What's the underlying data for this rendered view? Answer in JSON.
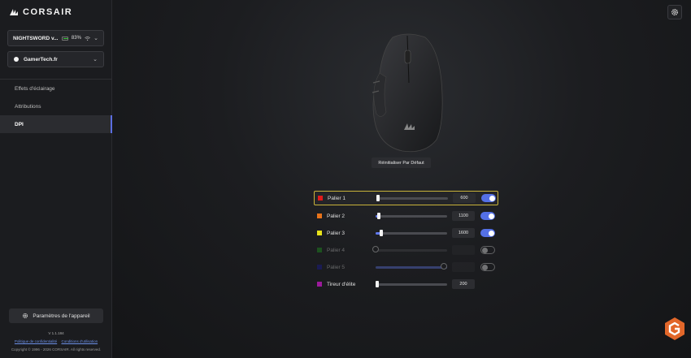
{
  "app": {
    "logo_text": "CORSAIR"
  },
  "device": {
    "name": "NIGHTSWORD v...",
    "battery": "83%"
  },
  "profile": {
    "name": "GamerTech.fr"
  },
  "nav": {
    "items": [
      {
        "label": "Effets d'éclairage"
      },
      {
        "label": "Attributions"
      },
      {
        "label": "DPI"
      }
    ],
    "active": "DPI"
  },
  "footer": {
    "settings_label": "Paramètres de l'appareil",
    "version": "V 1.1.184",
    "privacy_link": "Politique de confidentialité",
    "terms_link": "Conditions d'utilisation",
    "copyright": "Copyright © 1996 - 2026 CORSAIR. All rights reserved."
  },
  "main": {
    "reset_label": "Réinitialiser Par Défaut",
    "dpi_rows": [
      {
        "label": "Palier 1",
        "color": "#e01b1b",
        "value": "600",
        "level": 0.02,
        "enabled": true,
        "has_toggle": true,
        "selected": true
      },
      {
        "label": "Palier 2",
        "color": "#e8731a",
        "value": "1100",
        "level": 0.05,
        "enabled": true,
        "has_toggle": true,
        "selected": false
      },
      {
        "label": "Palier 3",
        "color": "#e8e21a",
        "value": "1600",
        "level": 0.08,
        "enabled": true,
        "has_toggle": true,
        "selected": false
      },
      {
        "label": "Palier 4",
        "color": "#1fa51f",
        "value": "",
        "level": 0.0,
        "enabled": false,
        "has_toggle": true,
        "selected": false
      },
      {
        "label": "Palier 5",
        "color": "#1a1aa8",
        "value": "",
        "level": 1.0,
        "enabled": false,
        "has_toggle": true,
        "selected": false
      },
      {
        "label": "Tireur d'élite",
        "color": "#9b1a9b",
        "value": "200",
        "level": 0.0,
        "enabled": true,
        "has_toggle": false,
        "selected": false
      }
    ]
  },
  "icons": {
    "logo": "corsair-sails-icon",
    "wifi": "wifi-icon",
    "gear": "gear-icon",
    "badge": "gamertech-logo"
  }
}
